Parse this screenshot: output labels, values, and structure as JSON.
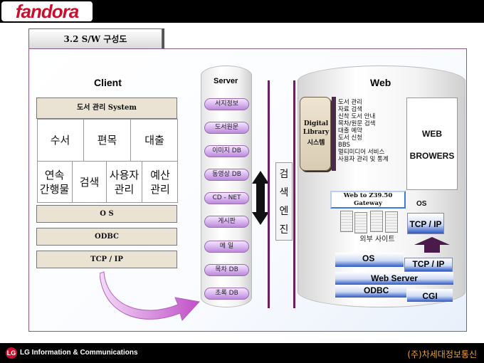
{
  "header": {
    "logo_text": "fandora"
  },
  "footer": {
    "lg_logo_glyph": "LG",
    "lg_text": "LG Information & Communications",
    "company": "(주)차세대정보통신"
  },
  "section_title": "3.2  S/W 구성도",
  "client": {
    "title": "Client",
    "system_box": "도서 관리 System",
    "modules": [
      "수서",
      "편목",
      "대출",
      "연속\n간행물",
      "검색",
      "사용자\n관리",
      "예산\n관리"
    ],
    "layers": [
      "O S",
      "ODBC",
      "TCP / IP"
    ]
  },
  "server": {
    "title": "Server",
    "items": [
      "서지정보",
      "도서원문",
      "이미지 DB",
      "동영상 DB",
      "CD - NET",
      "게시판",
      "메 일",
      "목차 DB",
      "초록 DB"
    ]
  },
  "search_engine": {
    "chars": [
      "검",
      "색",
      "엔",
      "진"
    ]
  },
  "web": {
    "title": "Web",
    "digital_library": [
      "Digital",
      "Library",
      "시스템"
    ],
    "services": [
      "도서 관리",
      "자료 검색",
      "신착 도서 안내",
      "목차/원문 검색",
      "대출 예약",
      "도서 신청",
      "BBS",
      "멀티미디어 서비스",
      "사용자 관리 및 통계"
    ],
    "browser": [
      "WEB",
      "BROWERS"
    ],
    "browser_os": "OS",
    "browser_tcp": "TCP / IP",
    "gateway": [
      "Web to Z39.50",
      "Gateway"
    ],
    "external_site": "외부 사이트",
    "stack": {
      "os": "OS",
      "tcp": "TCP / IP",
      "web_server": "Web Server",
      "odbc": "ODBC",
      "cgi": "CGI"
    }
  },
  "colors": {
    "accent_purple": "#b98ad8",
    "divider": "#6b1f5f",
    "stack_blue": "#2c58c8",
    "footer_text": "#e9a23b",
    "logo_red": "#c8102e"
  }
}
